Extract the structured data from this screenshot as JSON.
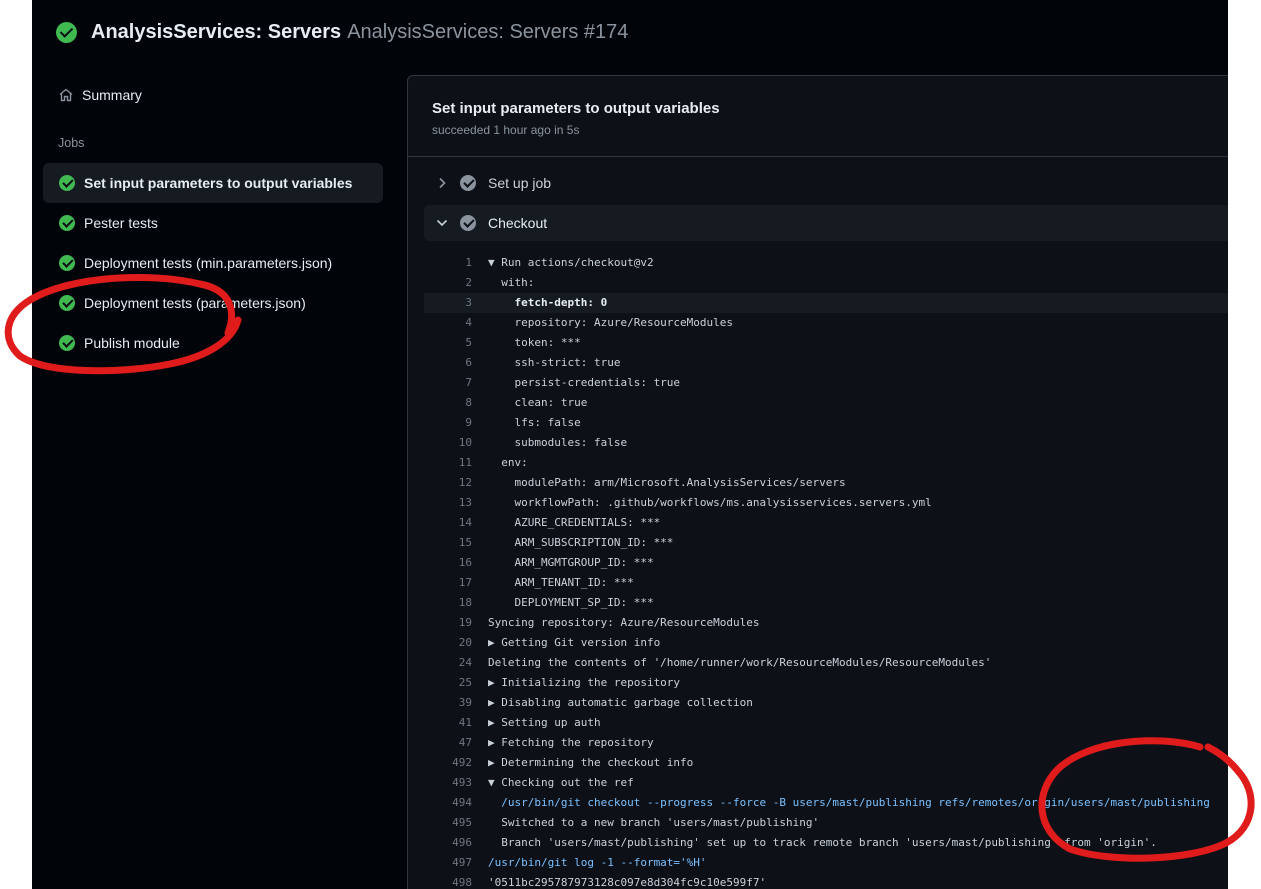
{
  "header": {
    "title": "AnalysisServices: Servers",
    "subtitle": "AnalysisServices: Servers #174"
  },
  "sidebar": {
    "summary_label": "Summary",
    "jobs_heading": "Jobs",
    "jobs": [
      {
        "label": "Set input parameters to output variables",
        "active": true
      },
      {
        "label": "Pester tests"
      },
      {
        "label": "Deployment tests (min.parameters.json)"
      },
      {
        "label": "Deployment tests (parameters.json)"
      },
      {
        "label": "Publish module"
      }
    ]
  },
  "job": {
    "title": "Set input parameters to output variables",
    "status": "succeeded 1 hour ago in 5s",
    "steps": [
      {
        "label": "Set up job",
        "expanded": false
      },
      {
        "label": "Checkout",
        "expanded": true
      }
    ]
  },
  "log": [
    {
      "n": "1",
      "t": "▼ Run actions/checkout@v2"
    },
    {
      "n": "2",
      "t": "  with:"
    },
    {
      "n": "3",
      "t": "    fetch-depth: 0",
      "hl": true
    },
    {
      "n": "4",
      "t": "    repository: Azure/ResourceModules"
    },
    {
      "n": "5",
      "t": "    token: ***"
    },
    {
      "n": "6",
      "t": "    ssh-strict: true"
    },
    {
      "n": "7",
      "t": "    persist-credentials: true"
    },
    {
      "n": "8",
      "t": "    clean: true"
    },
    {
      "n": "9",
      "t": "    lfs: false"
    },
    {
      "n": "10",
      "t": "    submodules: false"
    },
    {
      "n": "11",
      "t": "  env:"
    },
    {
      "n": "12",
      "t": "    modulePath: arm/Microsoft.AnalysisServices/servers"
    },
    {
      "n": "13",
      "t": "    workflowPath: .github/workflows/ms.analysisservices.servers.yml"
    },
    {
      "n": "14",
      "t": "    AZURE_CREDENTIALS: ***"
    },
    {
      "n": "15",
      "t": "    ARM_SUBSCRIPTION_ID: ***"
    },
    {
      "n": "16",
      "t": "    ARM_MGMTGROUP_ID: ***"
    },
    {
      "n": "17",
      "t": "    ARM_TENANT_ID: ***"
    },
    {
      "n": "18",
      "t": "    DEPLOYMENT_SP_ID: ***"
    },
    {
      "n": "19",
      "t": "Syncing repository: Azure/ResourceModules"
    },
    {
      "n": "20",
      "t": "▶ Getting Git version info"
    },
    {
      "n": "24",
      "t": "Deleting the contents of '/home/runner/work/ResourceModules/ResourceModules'"
    },
    {
      "n": "25",
      "t": "▶ Initializing the repository"
    },
    {
      "n": "39",
      "t": "▶ Disabling automatic garbage collection"
    },
    {
      "n": "41",
      "t": "▶ Setting up auth"
    },
    {
      "n": "47",
      "t": "▶ Fetching the repository"
    },
    {
      "n": "492",
      "t": "▶ Determining the checkout info"
    },
    {
      "n": "493",
      "t": "▼ Checking out the ref"
    },
    {
      "n": "494",
      "t": "  /usr/bin/git checkout --progress --force -B users/mast/publishing refs/remotes/origin/users/mast/publishing",
      "cmd": true
    },
    {
      "n": "495",
      "t": "  Switched to a new branch 'users/mast/publishing'"
    },
    {
      "n": "496",
      "t": "  Branch 'users/mast/publishing' set up to track remote branch 'users/mast/publishing' from 'origin'."
    },
    {
      "n": "497",
      "t": "/usr/bin/git log -1 --format='%H'",
      "cmd": true
    },
    {
      "n": "498",
      "t": "'0511bc295787973128c097e8d304fc9c10e599f7'"
    }
  ],
  "colors": {
    "success": "#3fb950",
    "annotation": "#e01b1b"
  }
}
